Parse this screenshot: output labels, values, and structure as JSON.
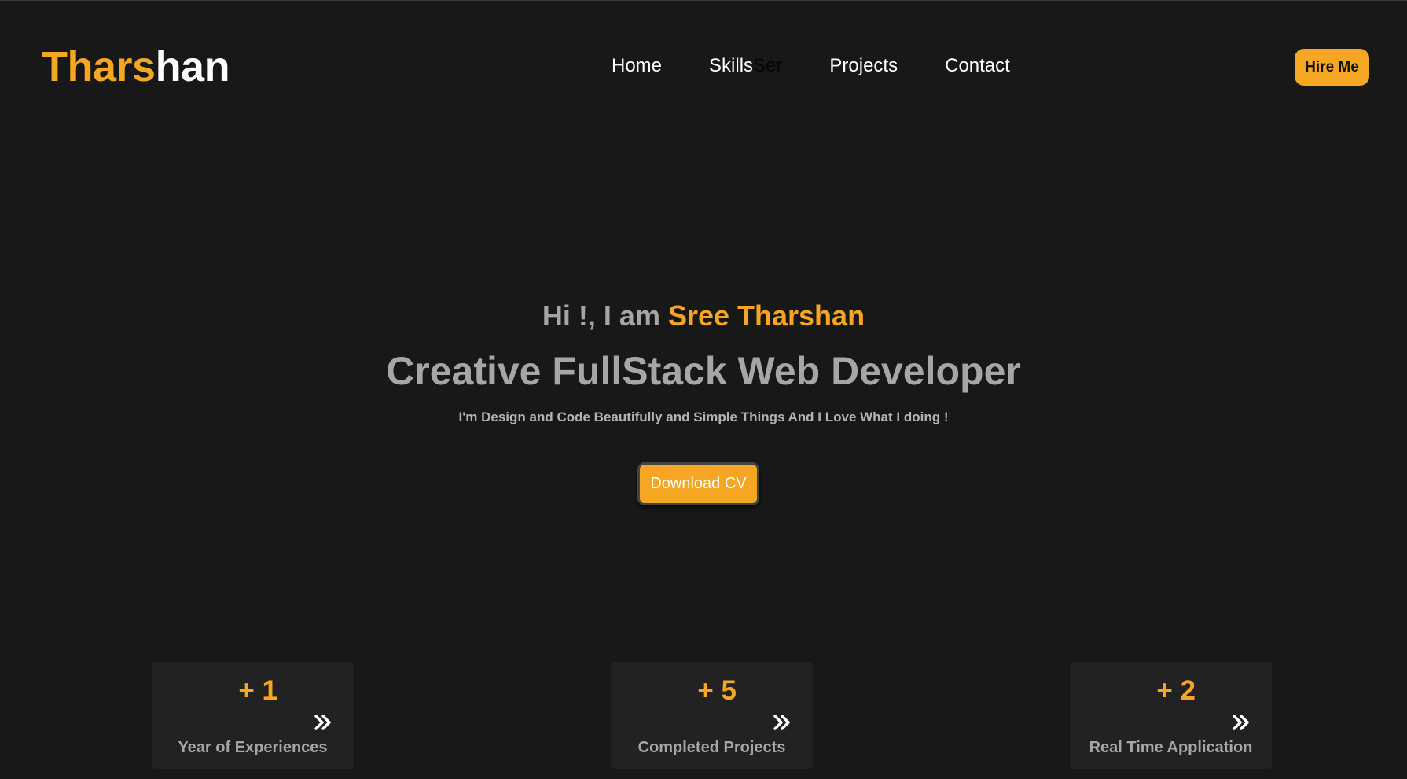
{
  "header": {
    "logo_first": "Thars",
    "logo_second": "han",
    "nav": [
      "Home",
      "Skills",
      "Ser",
      "Projects",
      "Contact"
    ],
    "hire_label": "Hire Me"
  },
  "hero": {
    "greeting_prefix": "Hi !, I am ",
    "greeting_name": "Sree Tharshan",
    "headline": "Creative FullStack Web Developer",
    "tagline": "I'm Design and Code Beautifully and Simple Things And I Love What I doing !",
    "cta_label": "Download CV"
  },
  "stats": [
    {
      "value": "+ 1",
      "label": "Year of Experiences",
      "icon": "double-chevron-right-icon"
    },
    {
      "value": "+ 5",
      "label": "Completed Projects",
      "icon": "double-chevron-right-icon"
    },
    {
      "value": "+ 2",
      "label": "Real Time Application",
      "icon": "double-chevron-right-icon"
    }
  ],
  "colors": {
    "background": "#181818",
    "accent": "#f5a623",
    "card": "#222222",
    "muted_text": "#a6a6a6"
  }
}
